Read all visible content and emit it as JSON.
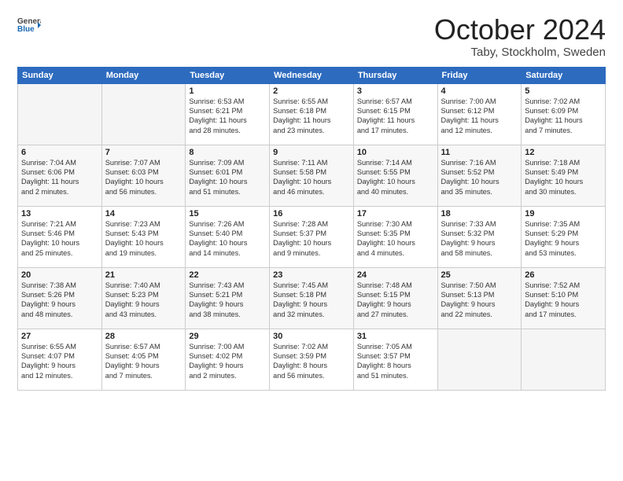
{
  "logo": {
    "line1": "General",
    "line2": "Blue"
  },
  "title": "October 2024",
  "subtitle": "Taby, Stockholm, Sweden",
  "days_header": [
    "Sunday",
    "Monday",
    "Tuesday",
    "Wednesday",
    "Thursday",
    "Friday",
    "Saturday"
  ],
  "weeks": [
    [
      {
        "day": "",
        "info": ""
      },
      {
        "day": "",
        "info": ""
      },
      {
        "day": "1",
        "info": "Sunrise: 6:53 AM\nSunset: 6:21 PM\nDaylight: 11 hours\nand 28 minutes."
      },
      {
        "day": "2",
        "info": "Sunrise: 6:55 AM\nSunset: 6:18 PM\nDaylight: 11 hours\nand 23 minutes."
      },
      {
        "day": "3",
        "info": "Sunrise: 6:57 AM\nSunset: 6:15 PM\nDaylight: 11 hours\nand 17 minutes."
      },
      {
        "day": "4",
        "info": "Sunrise: 7:00 AM\nSunset: 6:12 PM\nDaylight: 11 hours\nand 12 minutes."
      },
      {
        "day": "5",
        "info": "Sunrise: 7:02 AM\nSunset: 6:09 PM\nDaylight: 11 hours\nand 7 minutes."
      }
    ],
    [
      {
        "day": "6",
        "info": "Sunrise: 7:04 AM\nSunset: 6:06 PM\nDaylight: 11 hours\nand 2 minutes."
      },
      {
        "day": "7",
        "info": "Sunrise: 7:07 AM\nSunset: 6:03 PM\nDaylight: 10 hours\nand 56 minutes."
      },
      {
        "day": "8",
        "info": "Sunrise: 7:09 AM\nSunset: 6:01 PM\nDaylight: 10 hours\nand 51 minutes."
      },
      {
        "day": "9",
        "info": "Sunrise: 7:11 AM\nSunset: 5:58 PM\nDaylight: 10 hours\nand 46 minutes."
      },
      {
        "day": "10",
        "info": "Sunrise: 7:14 AM\nSunset: 5:55 PM\nDaylight: 10 hours\nand 40 minutes."
      },
      {
        "day": "11",
        "info": "Sunrise: 7:16 AM\nSunset: 5:52 PM\nDaylight: 10 hours\nand 35 minutes."
      },
      {
        "day": "12",
        "info": "Sunrise: 7:18 AM\nSunset: 5:49 PM\nDaylight: 10 hours\nand 30 minutes."
      }
    ],
    [
      {
        "day": "13",
        "info": "Sunrise: 7:21 AM\nSunset: 5:46 PM\nDaylight: 10 hours\nand 25 minutes."
      },
      {
        "day": "14",
        "info": "Sunrise: 7:23 AM\nSunset: 5:43 PM\nDaylight: 10 hours\nand 19 minutes."
      },
      {
        "day": "15",
        "info": "Sunrise: 7:26 AM\nSunset: 5:40 PM\nDaylight: 10 hours\nand 14 minutes."
      },
      {
        "day": "16",
        "info": "Sunrise: 7:28 AM\nSunset: 5:37 PM\nDaylight: 10 hours\nand 9 minutes."
      },
      {
        "day": "17",
        "info": "Sunrise: 7:30 AM\nSunset: 5:35 PM\nDaylight: 10 hours\nand 4 minutes."
      },
      {
        "day": "18",
        "info": "Sunrise: 7:33 AM\nSunset: 5:32 PM\nDaylight: 9 hours\nand 58 minutes."
      },
      {
        "day": "19",
        "info": "Sunrise: 7:35 AM\nSunset: 5:29 PM\nDaylight: 9 hours\nand 53 minutes."
      }
    ],
    [
      {
        "day": "20",
        "info": "Sunrise: 7:38 AM\nSunset: 5:26 PM\nDaylight: 9 hours\nand 48 minutes."
      },
      {
        "day": "21",
        "info": "Sunrise: 7:40 AM\nSunset: 5:23 PM\nDaylight: 9 hours\nand 43 minutes."
      },
      {
        "day": "22",
        "info": "Sunrise: 7:43 AM\nSunset: 5:21 PM\nDaylight: 9 hours\nand 38 minutes."
      },
      {
        "day": "23",
        "info": "Sunrise: 7:45 AM\nSunset: 5:18 PM\nDaylight: 9 hours\nand 32 minutes."
      },
      {
        "day": "24",
        "info": "Sunrise: 7:48 AM\nSunset: 5:15 PM\nDaylight: 9 hours\nand 27 minutes."
      },
      {
        "day": "25",
        "info": "Sunrise: 7:50 AM\nSunset: 5:13 PM\nDaylight: 9 hours\nand 22 minutes."
      },
      {
        "day": "26",
        "info": "Sunrise: 7:52 AM\nSunset: 5:10 PM\nDaylight: 9 hours\nand 17 minutes."
      }
    ],
    [
      {
        "day": "27",
        "info": "Sunrise: 6:55 AM\nSunset: 4:07 PM\nDaylight: 9 hours\nand 12 minutes."
      },
      {
        "day": "28",
        "info": "Sunrise: 6:57 AM\nSunset: 4:05 PM\nDaylight: 9 hours\nand 7 minutes."
      },
      {
        "day": "29",
        "info": "Sunrise: 7:00 AM\nSunset: 4:02 PM\nDaylight: 9 hours\nand 2 minutes."
      },
      {
        "day": "30",
        "info": "Sunrise: 7:02 AM\nSunset: 3:59 PM\nDaylight: 8 hours\nand 56 minutes."
      },
      {
        "day": "31",
        "info": "Sunrise: 7:05 AM\nSunset: 3:57 PM\nDaylight: 8 hours\nand 51 minutes."
      },
      {
        "day": "",
        "info": ""
      },
      {
        "day": "",
        "info": ""
      }
    ]
  ]
}
